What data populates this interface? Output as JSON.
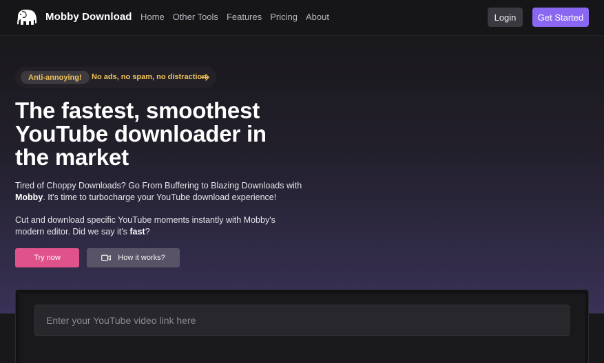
{
  "header": {
    "brand": "Mobby Download",
    "nav": [
      "Home",
      "Other Tools",
      "Features",
      "Pricing",
      "About"
    ],
    "login_label": "Login",
    "get_started_label": "Get Started"
  },
  "announcement": {
    "badge": "Anti-annoying!",
    "text": "No ads, no spam, no distraction",
    "arrow_icon": "arrow-right-icon"
  },
  "hero": {
    "headline_lines": [
      "The fastest, smoothest",
      "YouTube downloader in",
      "the market"
    ],
    "paragraph1": {
      "before": "Tired of Choppy Downloads? Go From Buffering to Blazing Downloads with ",
      "bold": "Mobby",
      "after": ". It's time to turbocharge your YouTube download experience!"
    },
    "paragraph2": {
      "before": "Cut and download specific YouTube moments instantly with Mobby's modern editor. Did we say it's ",
      "bold": "fast",
      "after": "?"
    },
    "try_label": "Try now",
    "how_label": "How it works?"
  },
  "search": {
    "placeholder": "Enter your YouTube video link here",
    "value": ""
  },
  "colors": {
    "accent_purple": "#8a67f2",
    "accent_pink": "#e0528b",
    "badge_yellow": "#f0c35a"
  }
}
